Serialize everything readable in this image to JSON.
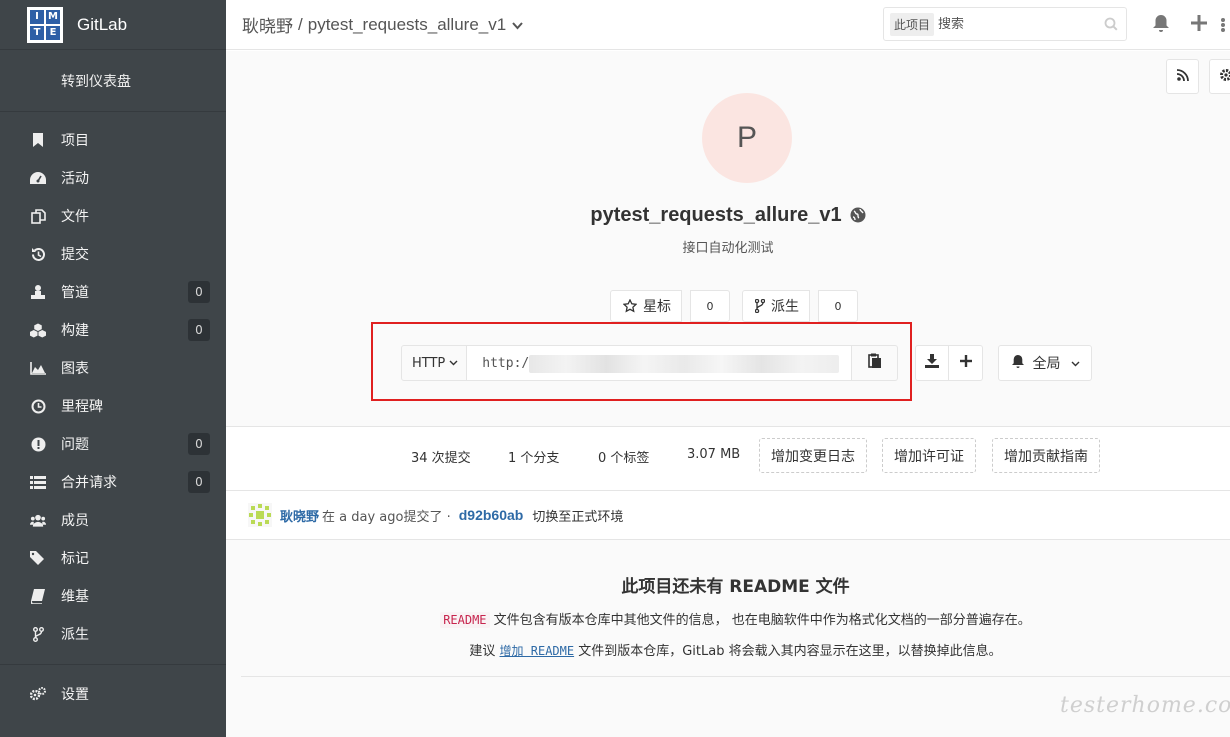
{
  "sidebar": {
    "brand": "GitLab",
    "logo_letters": [
      "I",
      "M",
      "T",
      "E"
    ],
    "back_to_dashboard": "转到仪表盘",
    "items": [
      {
        "label": "项目",
        "icon": "bookmark-icon"
      },
      {
        "label": "活动",
        "icon": "dashboard-icon"
      },
      {
        "label": "文件",
        "icon": "files-icon"
      },
      {
        "label": "提交",
        "icon": "history-icon"
      },
      {
        "label": "管道",
        "icon": "pipeline-icon",
        "count": "0"
      },
      {
        "label": "构建",
        "icon": "cubes-icon",
        "count": "0"
      },
      {
        "label": "图表",
        "icon": "area-chart-icon"
      },
      {
        "label": "里程碑",
        "icon": "clock-icon"
      },
      {
        "label": "问题",
        "icon": "exclamation-icon",
        "count": "0"
      },
      {
        "label": "合并请求",
        "icon": "list-icon",
        "count": "0"
      },
      {
        "label": "成员",
        "icon": "users-icon"
      },
      {
        "label": "标记",
        "icon": "tags-icon"
      },
      {
        "label": "维基",
        "icon": "book-icon"
      },
      {
        "label": "派生",
        "icon": "fork-icon"
      }
    ],
    "settings": "设置"
  },
  "header": {
    "owner": "耿晓野",
    "separator": "/",
    "project": "pytest_requests_allure_v1",
    "search_scope": "此项目",
    "search_placeholder": "搜索"
  },
  "project": {
    "avatar_letter": "P",
    "name": "pytest_requests_allure_v1",
    "description": "接口自动化测试",
    "star_label": "星标",
    "star_count": "0",
    "fork_label": "派生",
    "fork_count": "0",
    "clone_protocol": "HTTP",
    "clone_url": "http:/",
    "notification_level": "全局"
  },
  "stats": {
    "commits": "34 次提交",
    "branches": "1 个分支",
    "tags": "0 个标签",
    "size": "3.07 MB",
    "add_changelog": "增加变更日志",
    "add_license": "增加许可证",
    "add_contributing": "增加贡献指南"
  },
  "last_commit": {
    "author": "耿晓野",
    "text": "在 a day ago提交了 ·",
    "sha": "d92b60ab",
    "message": "切换至正式环境"
  },
  "readme": {
    "title": "此项目还未有 README 文件",
    "code_word": "README",
    "line1_rest": " 文件包含有版本仓库中其他文件的信息， 也在电脑软件中作为格式化文档的一部分普遍存在。",
    "line2_pre": "建议 ",
    "line2_link": "增加 README",
    "line2_post": " 文件到版本仓库，GitLab 将会载入其内容显示在这里，以替换掉此信息。"
  },
  "watermark": "testerhome.com",
  "colors": {
    "sidebar_bg": "#3f4549",
    "link": "#2e6aa6",
    "highlight_box": "#e02020",
    "avatar_bg": "#fbe5e1"
  }
}
